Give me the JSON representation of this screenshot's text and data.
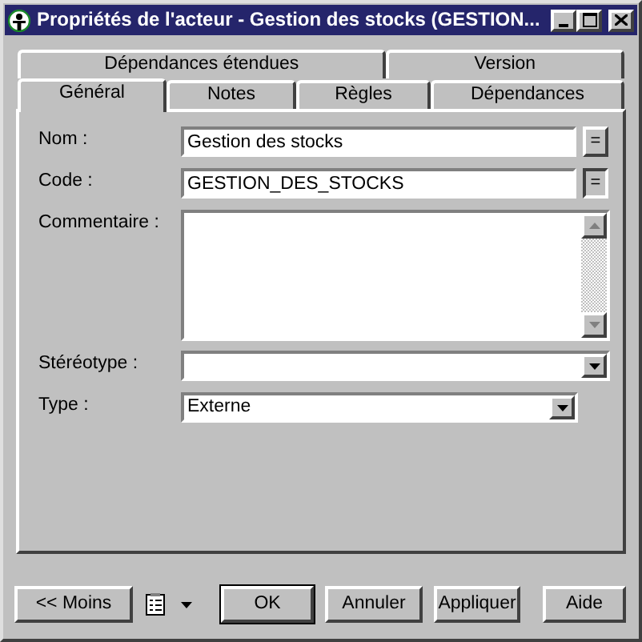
{
  "window": {
    "title": "Propriétés de l'acteur - Gestion des stocks (GESTION..."
  },
  "tab_rows": [
    [
      {
        "label": "Dépendances étendues",
        "selected": false
      },
      {
        "label": "Version",
        "selected": false
      }
    ],
    [
      {
        "label": "Général",
        "selected": true
      },
      {
        "label": "Notes",
        "selected": false
      },
      {
        "label": "Règles",
        "selected": false
      },
      {
        "label": "Dépendances",
        "selected": false
      }
    ]
  ],
  "fields": [
    {
      "kind": "text",
      "label": "Nom :",
      "value": "Gestion des stocks",
      "eq_button": {
        "label": "=",
        "pressed": false
      }
    },
    {
      "kind": "text",
      "label": "Code :",
      "value": "GESTION_DES_STOCKS",
      "eq_button": {
        "label": "=",
        "pressed": true
      }
    },
    {
      "kind": "textarea",
      "label": "Commentaire :"
    },
    {
      "kind": "combo",
      "label": "Stéréotype :",
      "wide": true
    },
    {
      "kind": "combo",
      "label": "Type :",
      "value": "Externe",
      "wide": false
    }
  ],
  "footer": [
    {
      "kind": "button",
      "label": "<< Moins",
      "default": false
    },
    {
      "kind": "menu"
    },
    {
      "kind": "button",
      "label": "OK",
      "default": true
    },
    {
      "kind": "button",
      "label": "Annuler",
      "default": false
    },
    {
      "kind": "button",
      "label": "Appliquer",
      "default": false
    },
    {
      "kind": "button",
      "label": "Aide",
      "default": false
    }
  ]
}
